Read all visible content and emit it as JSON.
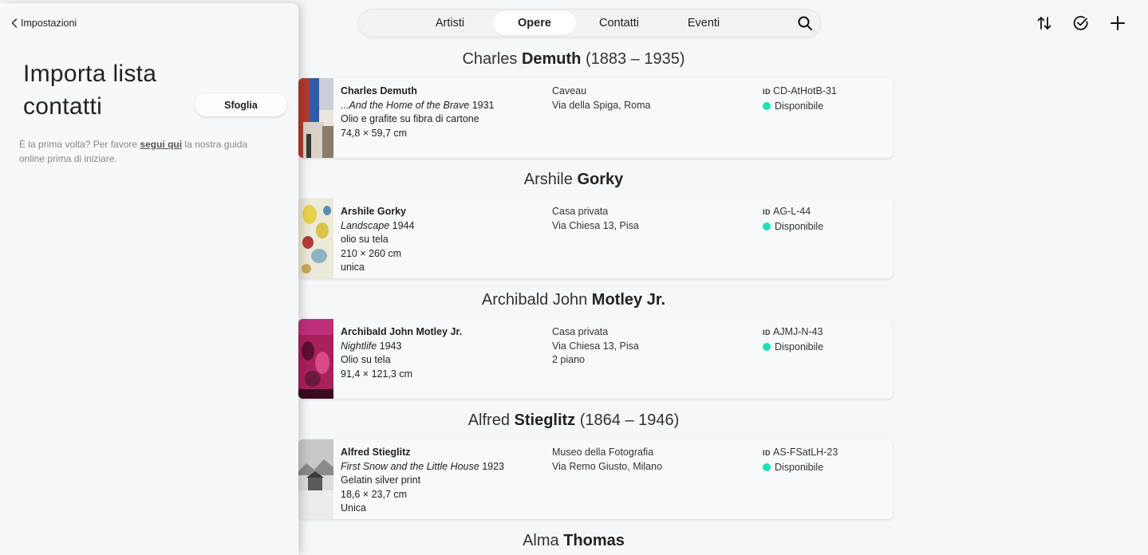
{
  "panel": {
    "back_label": "Impostazioni",
    "title": "Importa lista contatti",
    "browse_label": "Sfoglia",
    "help_before": "È la prima volta? Per favore ",
    "help_link": "segui qui",
    "help_after": " la nostra guida online prima di iniziare."
  },
  "nav": {
    "tabs": [
      {
        "label": "Artisti"
      },
      {
        "label": "Opere"
      },
      {
        "label": "Contatti"
      },
      {
        "label": "Eventi"
      }
    ],
    "active_tab": "Opere"
  },
  "status_color": "#1fe0b5",
  "sections": [
    {
      "first": "Charles",
      "last": "Demuth",
      "years": "(1883 – 1935)",
      "artist": "Charles Demuth",
      "title": "...And the Home of the Brave",
      "year": "1931",
      "lines": [
        "Olio e grafite su fibra di cartone",
        "74,8 × 59,7 cm"
      ],
      "loc": [
        "Caveau",
        "Via della Spiga, Roma"
      ],
      "id_label": "ID",
      "id": "CD-AtHotB-31",
      "status": "Disponibile"
    },
    {
      "first": "Arshile",
      "last": "Gorky",
      "years": "",
      "artist": "Arshile Gorky",
      "title": "Landscape",
      "year": "1944",
      "lines": [
        "olio su tela",
        "210 × 260 cm",
        "unica"
      ],
      "loc": [
        "Casa privata",
        "Via Chiesa 13, Pisa"
      ],
      "id_label": "ID",
      "id": "AG-L-44",
      "status": "Disponibile"
    },
    {
      "first": "Archibald John",
      "last": "Motley Jr.",
      "years": "",
      "artist": "Archibald John Motley Jr.",
      "title": "Nightlife",
      "year": "1943",
      "lines": [
        "Olio su tela",
        "91,4 × 121,3 cm"
      ],
      "loc": [
        "Casa privata",
        "Via Chiesa 13, Pisa",
        "2 piano"
      ],
      "id_label": "ID",
      "id": "AJMJ-N-43",
      "status": "Disponibile"
    },
    {
      "first": "Alfred",
      "last": "Stieglitz",
      "years": "(1864 – 1946)",
      "artist": "Alfred Stieglitz",
      "title": "First Snow and the Little House",
      "year": "1923",
      "lines": [
        "Gelatin silver print",
        "18,6 × 23,7 cm",
        "Unica"
      ],
      "loc": [
        "Museo della Fotografia",
        "Via Remo Giusto, Milano"
      ],
      "id_label": "ID",
      "id": "AS-FSatLH-23",
      "status": "Disponibile"
    },
    {
      "first": "Alma",
      "last": "Thomas",
      "years": ""
    }
  ]
}
